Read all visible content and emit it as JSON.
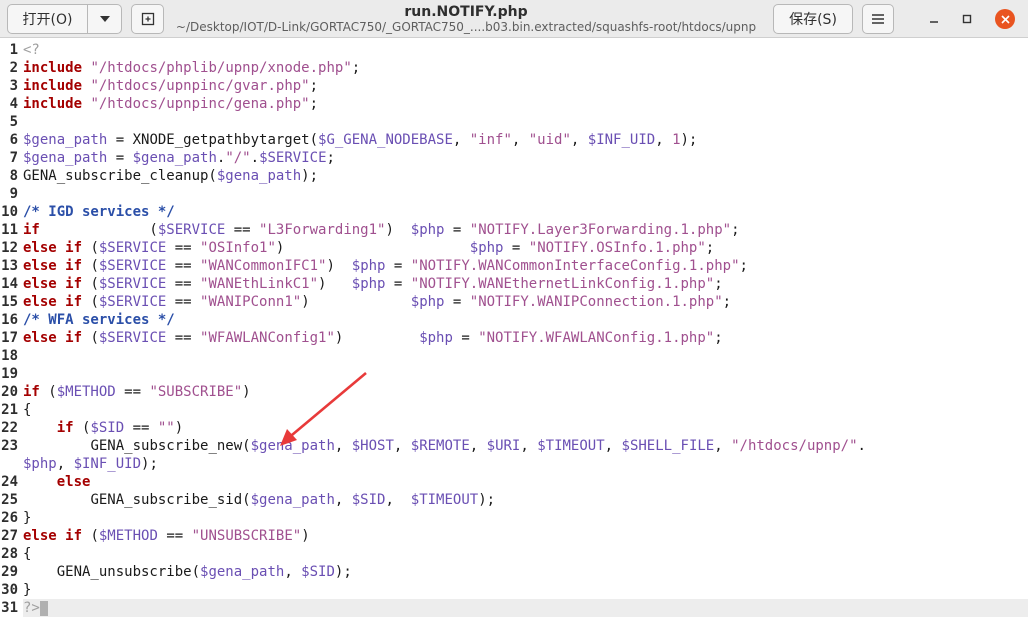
{
  "window": {
    "open_label": "打开(O)",
    "save_label": "保存(S)",
    "title": "run.NOTIFY.php",
    "path": "~/Desktop/IOT/D-Link/GORTAC750/_GORTAC750_....b03.bin.extracted/squashfs-root/htdocs/upnp"
  },
  "icons": {
    "dropdown": "chevron-down-icon",
    "new_tab": "new-document-icon",
    "menu": "hamburger-icon",
    "minimize": "minimize-icon",
    "maximize": "maximize-icon",
    "close": "close-icon"
  },
  "colors": {
    "keyword": "#a40000",
    "variable": "#6a4fb3",
    "string": "#a0508f",
    "comment": "#2b4fa8",
    "annotation": "#e83a3a",
    "close": "#e95420"
  },
  "editor": {
    "current_line": 31,
    "lines": [
      [
        [
          "tag",
          "<?"
        ]
      ],
      [
        [
          "kw",
          "include"
        ],
        [
          "",
          " "
        ],
        [
          "str",
          "\"/htdocs/phplib/upnp/xnode.php\""
        ],
        [
          "",
          ";"
        ]
      ],
      [
        [
          "kw",
          "include"
        ],
        [
          "",
          " "
        ],
        [
          "str",
          "\"/htdocs/upnpinc/gvar.php\""
        ],
        [
          "",
          ";"
        ]
      ],
      [
        [
          "kw",
          "include"
        ],
        [
          "",
          " "
        ],
        [
          "str",
          "\"/htdocs/upnpinc/gena.php\""
        ],
        [
          "",
          ";"
        ]
      ],
      [],
      [
        [
          "var",
          "$gena_path"
        ],
        [
          "",
          " = XNODE_getpathbytarget("
        ],
        [
          "var",
          "$G_GENA_NODEBASE"
        ],
        [
          "",
          ", "
        ],
        [
          "str",
          "\"inf\""
        ],
        [
          "",
          ", "
        ],
        [
          "str",
          "\"uid\""
        ],
        [
          "",
          ", "
        ],
        [
          "var",
          "$INF_UID"
        ],
        [
          "",
          ", "
        ],
        [
          "num",
          "1"
        ],
        [
          "",
          ");"
        ]
      ],
      [
        [
          "var",
          "$gena_path"
        ],
        [
          "",
          " = "
        ],
        [
          "var",
          "$gena_path"
        ],
        [
          "",
          "."
        ],
        [
          "str",
          "\"/\""
        ],
        [
          "",
          "."
        ],
        [
          "var",
          "$SERVICE"
        ],
        [
          "",
          ";"
        ]
      ],
      [
        [
          "",
          "GENA_subscribe_cleanup("
        ],
        [
          "var",
          "$gena_path"
        ],
        [
          "",
          ");"
        ]
      ],
      [],
      [
        [
          "cmt",
          "/* IGD services */"
        ]
      ],
      [
        [
          "kw",
          "if"
        ],
        [
          "",
          "             ("
        ],
        [
          "var",
          "$SERVICE"
        ],
        [
          "",
          " == "
        ],
        [
          "str",
          "\"L3Forwarding1\""
        ],
        [
          "",
          ")  "
        ],
        [
          "var",
          "$php"
        ],
        [
          "",
          " = "
        ],
        [
          "str",
          "\"NOTIFY.Layer3Forwarding.1.php\""
        ],
        [
          "",
          ";"
        ]
      ],
      [
        [
          "kw",
          "else if"
        ],
        [
          "",
          " ("
        ],
        [
          "var",
          "$SERVICE"
        ],
        [
          "",
          " == "
        ],
        [
          "str",
          "\"OSInfo1\""
        ],
        [
          "",
          ")                      "
        ],
        [
          "var",
          "$php"
        ],
        [
          "",
          " = "
        ],
        [
          "str",
          "\"NOTIFY.OSInfo.1.php\""
        ],
        [
          "",
          ";"
        ]
      ],
      [
        [
          "kw",
          "else if"
        ],
        [
          "",
          " ("
        ],
        [
          "var",
          "$SERVICE"
        ],
        [
          "",
          " == "
        ],
        [
          "str",
          "\"WANCommonIFC1\""
        ],
        [
          "",
          ")  "
        ],
        [
          "var",
          "$php"
        ],
        [
          "",
          " = "
        ],
        [
          "str",
          "\"NOTIFY.WANCommonInterfaceConfig.1.php\""
        ],
        [
          "",
          ";"
        ]
      ],
      [
        [
          "kw",
          "else if"
        ],
        [
          "",
          " ("
        ],
        [
          "var",
          "$SERVICE"
        ],
        [
          "",
          " == "
        ],
        [
          "str",
          "\"WANEthLinkC1\""
        ],
        [
          "",
          ")   "
        ],
        [
          "var",
          "$php"
        ],
        [
          "",
          " = "
        ],
        [
          "str",
          "\"NOTIFY.WANEthernetLinkConfig.1.php\""
        ],
        [
          "",
          ";"
        ]
      ],
      [
        [
          "kw",
          "else if"
        ],
        [
          "",
          " ("
        ],
        [
          "var",
          "$SERVICE"
        ],
        [
          "",
          " == "
        ],
        [
          "str",
          "\"WANIPConn1\""
        ],
        [
          "",
          ")            "
        ],
        [
          "var",
          "$php"
        ],
        [
          "",
          " = "
        ],
        [
          "str",
          "\"NOTIFY.WANIPConnection.1.php\""
        ],
        [
          "",
          ";"
        ]
      ],
      [
        [
          "cmt",
          "/* WFA services */"
        ]
      ],
      [
        [
          "kw",
          "else if"
        ],
        [
          "",
          " ("
        ],
        [
          "var",
          "$SERVICE"
        ],
        [
          "",
          " == "
        ],
        [
          "str",
          "\"WFAWLANConfig1\""
        ],
        [
          "",
          ")         "
        ],
        [
          "var",
          "$php"
        ],
        [
          "",
          " = "
        ],
        [
          "str",
          "\"NOTIFY.WFAWLANConfig.1.php\""
        ],
        [
          "",
          ";"
        ]
      ],
      [],
      [],
      [
        [
          "kw",
          "if"
        ],
        [
          "",
          " ("
        ],
        [
          "var",
          "$METHOD"
        ],
        [
          "",
          " == "
        ],
        [
          "str",
          "\"SUBSCRIBE\""
        ],
        [
          "",
          ")"
        ]
      ],
      [
        [
          "",
          "{"
        ]
      ],
      [
        [
          "",
          "\t"
        ],
        [
          "kw",
          "if"
        ],
        [
          "",
          " ("
        ],
        [
          "var",
          "$SID"
        ],
        [
          "",
          " == "
        ],
        [
          "str",
          "\"\""
        ],
        [
          "",
          ")"
        ]
      ],
      [
        [
          "",
          "\t\tGENA_subscribe_new("
        ],
        [
          "var",
          "$gena_path"
        ],
        [
          "",
          ", "
        ],
        [
          "var",
          "$HOST"
        ],
        [
          "",
          ", "
        ],
        [
          "var",
          "$REMOTE"
        ],
        [
          "",
          ", "
        ],
        [
          "var",
          "$URI"
        ],
        [
          "",
          ", "
        ],
        [
          "var",
          "$TIMEOUT"
        ],
        [
          "",
          ", "
        ],
        [
          "var",
          "$SHELL_FILE"
        ],
        [
          "",
          ", "
        ],
        [
          "str",
          "\"/htdocs/upnp/\""
        ],
        [
          "",
          "."
        ]
      ],
      [
        [
          "var",
          "$php"
        ],
        [
          "",
          ", "
        ],
        [
          "var",
          "$INF_UID"
        ],
        [
          "",
          ");"
        ]
      ],
      [
        [
          "",
          "\t"
        ],
        [
          "kw",
          "else"
        ]
      ],
      [
        [
          "",
          "\t\tGENA_subscribe_sid("
        ],
        [
          "var",
          "$gena_path"
        ],
        [
          "",
          ", "
        ],
        [
          "var",
          "$SID"
        ],
        [
          "",
          ",  "
        ],
        [
          "var",
          "$TIMEOUT"
        ],
        [
          "",
          ");"
        ]
      ],
      [
        [
          "",
          "}"
        ]
      ],
      [
        [
          "kw",
          "else if"
        ],
        [
          "",
          " ("
        ],
        [
          "var",
          "$METHOD"
        ],
        [
          "",
          " == "
        ],
        [
          "str",
          "\"UNSUBSCRIBE\""
        ],
        [
          "",
          ")"
        ]
      ],
      [
        [
          "",
          "{"
        ]
      ],
      [
        [
          "",
          "\tGENA_unsubscribe("
        ],
        [
          "var",
          "$gena_path"
        ],
        [
          "",
          ", "
        ],
        [
          "var",
          "$SID"
        ],
        [
          "",
          ");"
        ]
      ],
      [
        [
          "",
          "}"
        ]
      ],
      [
        [
          "tag",
          "?>"
        ]
      ]
    ],
    "line_numbers": [
      "1",
      "2",
      "3",
      "4",
      "5",
      "6",
      "7",
      "8",
      "9",
      "10",
      "11",
      "12",
      "13",
      "14",
      "15",
      "16",
      "17",
      "18",
      "19",
      "20",
      "21",
      "22",
      "23",
      "",
      "24",
      "25",
      "26",
      "27",
      "28",
      "29",
      "30",
      "31"
    ]
  }
}
